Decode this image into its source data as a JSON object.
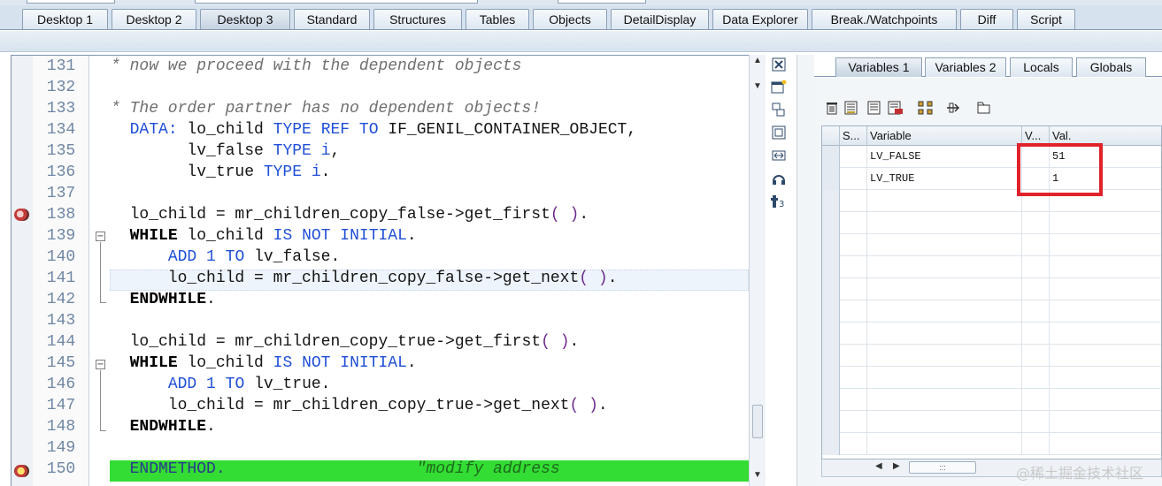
{
  "top_tabs": [
    {
      "label": "Desktop 1",
      "active": false
    },
    {
      "label": "Desktop 2",
      "active": false
    },
    {
      "label": "Desktop 3",
      "active": true
    },
    {
      "label": "Standard",
      "active": false
    },
    {
      "label": "Structures",
      "active": false
    },
    {
      "label": "Tables",
      "active": false
    },
    {
      "label": "Objects",
      "active": false
    },
    {
      "label": "DetailDisplay",
      "active": false
    },
    {
      "label": "Data Explorer",
      "active": false
    },
    {
      "label": "Break./Watchpoints",
      "active": false
    },
    {
      "label": "Diff",
      "active": false
    },
    {
      "label": "Script",
      "active": false
    }
  ],
  "editor": {
    "lines": [
      {
        "num": "131",
        "text": "* now we proceed with the dependent objects"
      },
      {
        "num": "132",
        "text": ""
      },
      {
        "num": "133",
        "text": "* The order partner has no dependent objects!"
      },
      {
        "num": "134",
        "text": "  DATA: lo_child TYPE REF TO IF_GENIL_CONTAINER_OBJECT,"
      },
      {
        "num": "135",
        "text": "        lv_false TYPE i,"
      },
      {
        "num": "136",
        "text": "        lv_true TYPE i."
      },
      {
        "num": "137",
        "text": ""
      },
      {
        "num": "138",
        "text": "  lo_child = mr_children_copy_false->get_first( )."
      },
      {
        "num": "139",
        "text": "  WHILE lo_child IS NOT INITIAL."
      },
      {
        "num": "140",
        "text": "      ADD 1 TO lv_false."
      },
      {
        "num": "141",
        "text": "      lo_child = mr_children_copy_false->get_next( )."
      },
      {
        "num": "142",
        "text": "  ENDWHILE."
      },
      {
        "num": "143",
        "text": ""
      },
      {
        "num": "144",
        "text": "  lo_child = mr_children_copy_true->get_first( )."
      },
      {
        "num": "145",
        "text": "  WHILE lo_child IS NOT INITIAL."
      },
      {
        "num": "146",
        "text": "      ADD 1 TO lv_true."
      },
      {
        "num": "147",
        "text": "      lo_child = mr_children_copy_true->get_next( )."
      },
      {
        "num": "148",
        "text": "  ENDWHILE."
      },
      {
        "num": "149",
        "text": ""
      },
      {
        "num": "150",
        "text": "  ENDMETHOD.                    \"modify address"
      }
    ]
  },
  "variables_panel": {
    "tabs": [
      "Variables 1",
      "Variables 2",
      "Locals",
      "Globals"
    ],
    "active_tab": "Variables 1",
    "columns": [
      "S...",
      "Variable",
      "V...",
      "Val."
    ],
    "rows": [
      {
        "variable": "LV_FALSE",
        "value": "51"
      },
      {
        "variable": "LV_TRUE",
        "value": "1"
      }
    ]
  },
  "watermark": "@稀土掘金技术社区",
  "colors": {
    "current_line_bg": "#33dd33",
    "highlight_box": "#e0222a",
    "keyword": "#1f4fd8"
  }
}
